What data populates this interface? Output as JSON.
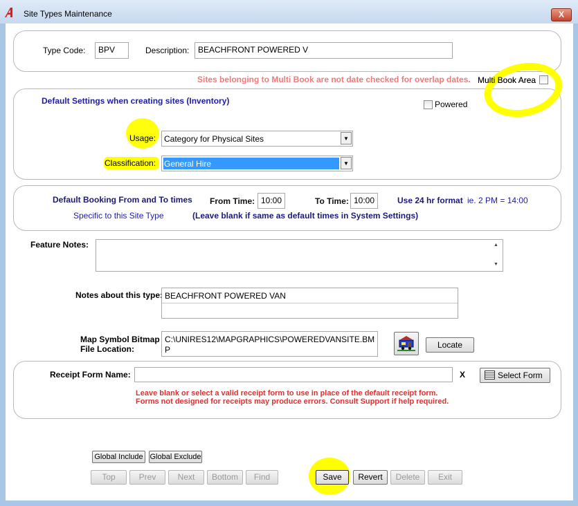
{
  "window": {
    "title": "Site Types Maintenance",
    "close_label": "X"
  },
  "type_code": {
    "label": "Type Code:",
    "value": "BPV"
  },
  "description": {
    "label": "Description:",
    "value": "BEACHFRONT POWERED V"
  },
  "multi_book": {
    "warning": "Sites belonging to Multi Book are not date checked for overlap dates.",
    "label": "Multi Book Area",
    "checked": false
  },
  "defaults": {
    "heading": "Default Settings when creating sites (Inventory)",
    "powered_label": "Powered",
    "powered_checked": false,
    "usage_label": "Usage:",
    "usage_value": "Category for Physical Sites",
    "classification_label": "Classification:",
    "classification_value": "General Hire"
  },
  "booking_times": {
    "heading": "Default Booking From and To times",
    "subheading": "Specific to this Site Type",
    "from_label": "From Time:",
    "from_value": "10:00",
    "to_label": "To Time:",
    "to_value": "10:00",
    "format_hint": "Use 24 hr format",
    "example": "ie. 2 PM = 14:00",
    "blank_hint": "(Leave blank if same as default times in System Settings)"
  },
  "feature_notes": {
    "label": "Feature Notes:",
    "value": ""
  },
  "type_notes": {
    "label": "Notes about this type:",
    "value": "BEACHFRONT POWERED VAN"
  },
  "map_symbol": {
    "label_line1": "Map Symbol Bitmap",
    "label_line2": "File Location:",
    "path_line1": "C:\\UNIRES12\\MAPGRAPHICS\\POWEREDVANSITE.BM",
    "path_line2": "P",
    "icon": "caravan-icon",
    "locate_label": "Locate"
  },
  "receipt": {
    "label": "Receipt Form Name:",
    "value": "",
    "clear_label": "X",
    "select_label": "Select Form",
    "note1": "Leave blank or select a valid receipt form to use in place of the default receipt form.",
    "note2": "Forms not designed for receipts may produce errors. Consult Support if help required."
  },
  "buttons": {
    "global_include": "Global Include",
    "global_exclude": "Global Exclude",
    "top": "Top",
    "prev": "Prev",
    "next": "Next",
    "bottom": "Bottom",
    "find": "Find",
    "save": "Save",
    "revert": "Revert",
    "delete": "Delete",
    "exit": "Exit"
  },
  "colors": {
    "frame": "#a9c6e6",
    "heading_blue": "#1c1ca8",
    "warning_red": "#e03030",
    "highlight_yellow": "#ffff00",
    "selection_blue": "#3399ff"
  }
}
